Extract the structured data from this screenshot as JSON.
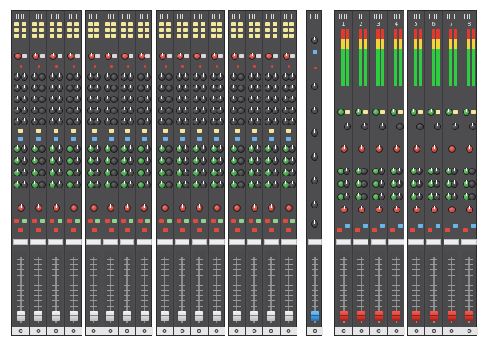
{
  "colors": {
    "panel": "#4d4d4f",
    "knob_green": "#2f9b3a",
    "knob_red": "#e14a3c",
    "button_yellow": "#f3e79a",
    "button_blue": "#6cb4e8",
    "fader_white": "#e8e8e8",
    "fader_red": "#d8332a",
    "fader_blue": "#2b8ad6"
  },
  "channel_bays": {
    "count": 4,
    "strips_per_bay": 4,
    "fader_cap": "white"
  },
  "master_section": {
    "fader_cap": "blue"
  },
  "group_section": {
    "bays": [
      {
        "numbers": [
          "1",
          "2",
          "3",
          "4"
        ]
      },
      {
        "numbers": [
          "5",
          "6",
          "7",
          "8"
        ]
      }
    ],
    "fader_cap": "red"
  }
}
